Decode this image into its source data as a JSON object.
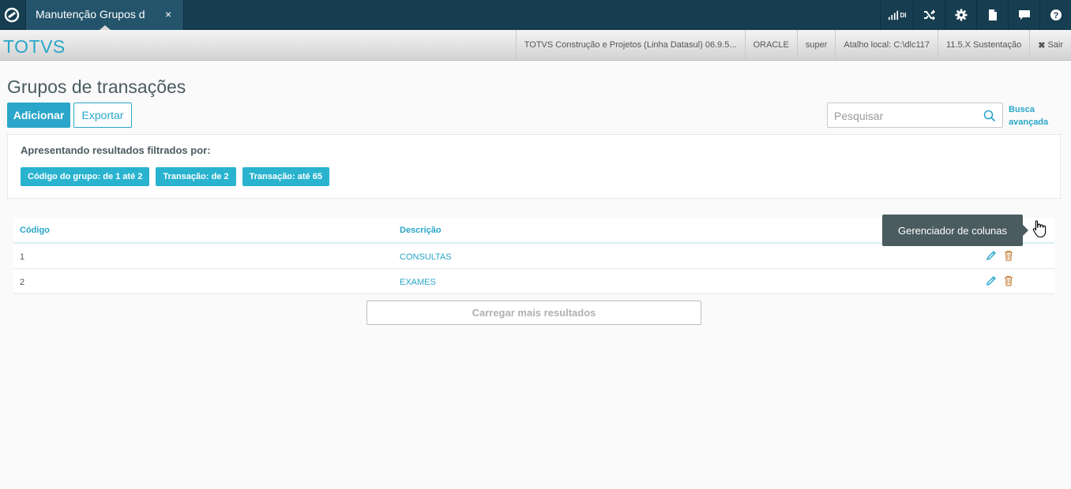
{
  "topbar": {
    "tab_label": "Manutenção Grupos d",
    "tab_close": "×",
    "signal_label": "DI",
    "icons": [
      "signal-icon",
      "shuffle-icon",
      "gear-icon",
      "file-icon",
      "chat-icon",
      "help-icon"
    ]
  },
  "infobar": {
    "brand": "TOTVS",
    "product": "TOTVS Construção e Projetos (Linha Datasul) 06.9.5...",
    "database": "ORACLE",
    "user": "super",
    "shortcut": "Atalho local: C:\\dlc117",
    "version": "11.5.X Sustentação",
    "exit_label": "Sair"
  },
  "page": {
    "title": "Grupos de transações",
    "add_label": "Adicionar",
    "export_label": "Exportar",
    "search_placeholder": "Pesquisar",
    "advanced_search_label": "Busca avançada"
  },
  "filters": {
    "title": "Apresentando resultados filtrados por:",
    "chips": [
      "Código do grupo: de 1 até 2",
      "Transação: de 2",
      "Transação: até 65"
    ]
  },
  "table": {
    "columns": [
      "Código",
      "Descrição"
    ],
    "rows": [
      {
        "code": "1",
        "description": "CONSULTAS"
      },
      {
        "code": "2",
        "description": "EXAMES"
      }
    ]
  },
  "load_more_label": "Carregar mais resultados",
  "tooltip": "Gerenciador de colunas",
  "colors": {
    "topbar": "#163d50",
    "accent": "#29a6c9",
    "chip": "#29b3cf",
    "tooltip": "#4a5c60",
    "delete": "#c8884a"
  }
}
